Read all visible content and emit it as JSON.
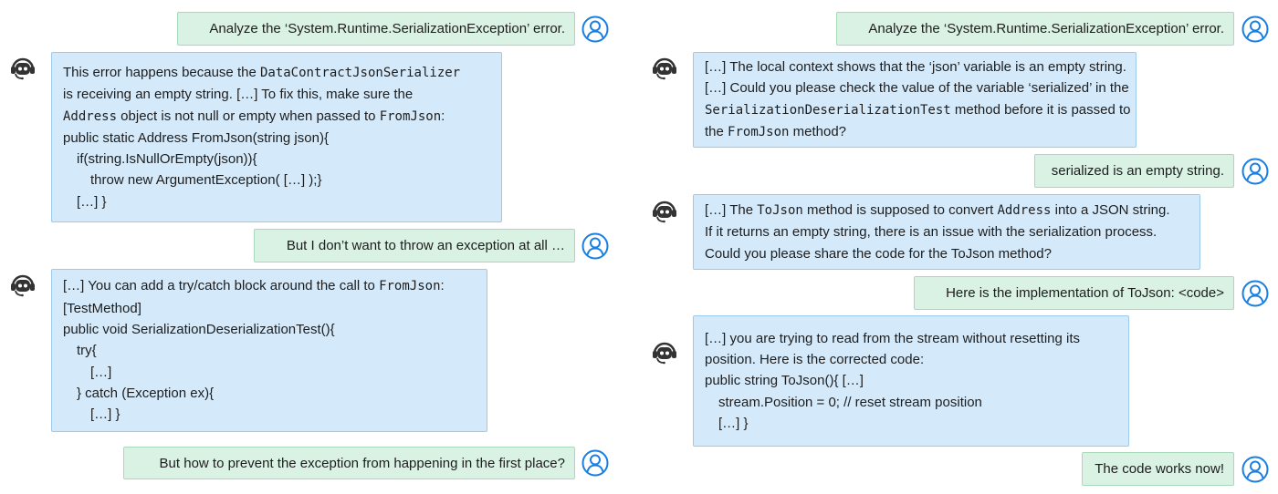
{
  "colors": {
    "user_bubble": "#d9f2e3",
    "bot_bubble": "#d4eafb",
    "user_icon": "#1a7fe0",
    "bot_icon": "#333333"
  },
  "conversations": [
    {
      "messages": [
        {
          "role": "user",
          "text": "Analyze the ‘System.Runtime.SerializationException’ error."
        },
        {
          "role": "bot",
          "lines": [
            {
              "indent": 0,
              "segs": [
                {
                  "t": "This error happens because the "
                },
                {
                  "t": "DataContractJsonSerializer",
                  "code": true
                }
              ]
            },
            {
              "indent": 0,
              "segs": [
                {
                  "t": "is receiving an empty string. […] To fix this, make sure the"
                }
              ]
            },
            {
              "indent": 0,
              "segs": [
                {
                  "t": "Address",
                  "code": true
                },
                {
                  "t": " object is not null or empty when passed to "
                },
                {
                  "t": "FromJson",
                  "code": true
                },
                {
                  "t": ":"
                }
              ]
            },
            {
              "indent": 0,
              "segs": [
                {
                  "t": "public static Address FromJson(string json){"
                }
              ]
            },
            {
              "indent": 1,
              "segs": [
                {
                  "t": "if(string.IsNullOrEmpty(json)){"
                }
              ]
            },
            {
              "indent": 2,
              "segs": [
                {
                  "t": "throw new ArgumentException( […] );}"
                }
              ]
            },
            {
              "indent": 1,
              "segs": [
                {
                  "t": "[…] }"
                }
              ]
            }
          ]
        },
        {
          "role": "user",
          "text": "But I don’t want to throw an exception at all …"
        },
        {
          "role": "bot",
          "lines": [
            {
              "indent": 0,
              "segs": [
                {
                  "t": "[…] You can add a try/catch block around the call to "
                },
                {
                  "t": "FromJson",
                  "code": true
                },
                {
                  "t": ":"
                }
              ]
            },
            {
              "indent": 0,
              "segs": [
                {
                  "t": "[TestMethod]"
                }
              ]
            },
            {
              "indent": 0,
              "segs": [
                {
                  "t": "public void SerializationDeserializationTest(){"
                }
              ]
            },
            {
              "indent": 1,
              "segs": [
                {
                  "t": "try{"
                }
              ]
            },
            {
              "indent": 2,
              "segs": [
                {
                  "t": "[…]"
                }
              ]
            },
            {
              "indent": 1,
              "segs": [
                {
                  "t": "} catch (Exception ex){"
                }
              ]
            },
            {
              "indent": 2,
              "segs": [
                {
                  "t": "[…] }"
                }
              ]
            }
          ]
        },
        {
          "role": "user",
          "text": "But how to prevent the exception from happening in the first place?"
        }
      ]
    },
    {
      "messages": [
        {
          "role": "user",
          "text": "Analyze the ‘System.Runtime.SerializationException’ error."
        },
        {
          "role": "bot",
          "lines": [
            {
              "indent": 0,
              "segs": [
                {
                  "t": "[…] The local context shows that the ‘json’ variable is an empty string."
                }
              ]
            },
            {
              "indent": 0,
              "segs": [
                {
                  "t": "[…] Could you please check the value of the variable ‘serialized’ in the"
                }
              ]
            },
            {
              "indent": 0,
              "segs": [
                {
                  "t": "SerializationDeserializationTest",
                  "code": true
                },
                {
                  "t": " method before it is passed to"
                }
              ]
            },
            {
              "indent": 0,
              "segs": [
                {
                  "t": "the "
                },
                {
                  "t": "FromJson",
                  "code": true
                },
                {
                  "t": " method?"
                }
              ]
            }
          ]
        },
        {
          "role": "user",
          "text": "serialized is an empty string."
        },
        {
          "role": "bot",
          "lines": [
            {
              "indent": 0,
              "segs": [
                {
                  "t": "[…] The "
                },
                {
                  "t": "ToJson",
                  "code": true
                },
                {
                  "t": " method is supposed to convert "
                },
                {
                  "t": "Address",
                  "code": true
                },
                {
                  "t": " into a JSON string."
                }
              ]
            },
            {
              "indent": 0,
              "segs": [
                {
                  "t": "If it returns an empty string, there is an issue with the serialization process."
                }
              ]
            },
            {
              "indent": 0,
              "segs": [
                {
                  "t": "Could you please share the code for the ToJson method?"
                }
              ]
            }
          ]
        },
        {
          "role": "user",
          "text": "Here is the implementation of ToJson: <code>"
        },
        {
          "role": "bot",
          "lines": [
            {
              "indent": 0,
              "segs": [
                {
                  "t": "[…] you are trying to read from the stream without resetting its"
                }
              ]
            },
            {
              "indent": 0,
              "segs": [
                {
                  "t": "position. Here is the corrected code:"
                }
              ]
            },
            {
              "indent": 0,
              "segs": [
                {
                  "t": "public string ToJson(){ […]"
                }
              ]
            },
            {
              "indent": 1,
              "segs": [
                {
                  "t": "stream.Position = 0; // reset stream position"
                }
              ]
            },
            {
              "indent": 1,
              "segs": [
                {
                  "t": "[…] }"
                }
              ]
            }
          ]
        },
        {
          "role": "user",
          "text": "The code works now!"
        }
      ]
    }
  ]
}
